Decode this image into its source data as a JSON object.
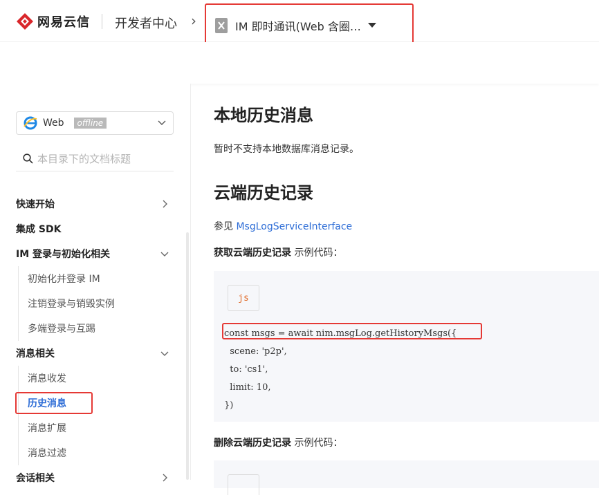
{
  "header": {
    "brand": "网易云信",
    "dev_center": "开发者中心",
    "crumb_arrow": "›",
    "product": "IM 即时通讯(Web 含圈…",
    "highlight_color": "#e53935"
  },
  "sidebar": {
    "platform": {
      "label": "Web",
      "badge": "offline"
    },
    "search": {
      "placeholder": "本目录下的文档标题"
    },
    "items": [
      {
        "label": "快速开始",
        "type": "group",
        "chevron": "right"
      },
      {
        "label": "集成 SDK",
        "type": "group",
        "chevron": ""
      },
      {
        "label": "IM 登录与初始化相关",
        "type": "group",
        "chevron": "down"
      },
      {
        "label": "初始化并登录 IM",
        "type": "sub"
      },
      {
        "label": "注销登录与销毁实例",
        "type": "sub"
      },
      {
        "label": "多端登录与互踢",
        "type": "sub"
      },
      {
        "label": "消息相关",
        "type": "group",
        "chevron": "down"
      },
      {
        "label": "消息收发",
        "type": "sub"
      },
      {
        "label": "历史消息",
        "type": "sub",
        "active": true
      },
      {
        "label": "消息扩展",
        "type": "sub"
      },
      {
        "label": "消息过滤",
        "type": "sub"
      },
      {
        "label": "会话相关",
        "type": "group",
        "chevron": "right"
      }
    ]
  },
  "content": {
    "h1": "本地历史消息",
    "p1": "暂时不支持本地数据库消息记录。",
    "h2": "云端历史记录",
    "ref_prefix": "参见 ",
    "ref_link": "MsgLogServiceInterface",
    "label1_bold": "获取云端历史记录",
    "label1_rest": " 示例代码：",
    "lang": "js",
    "code_lines": [
      "const msgs = await nim.msgLog.getHistoryMsgs({",
      "  scene: 'p2p',",
      "  to: 'cs1',",
      "  limit: 10,",
      "})"
    ],
    "label2_bold": "删除云端历史记录",
    "label2_rest": " 示例代码："
  }
}
